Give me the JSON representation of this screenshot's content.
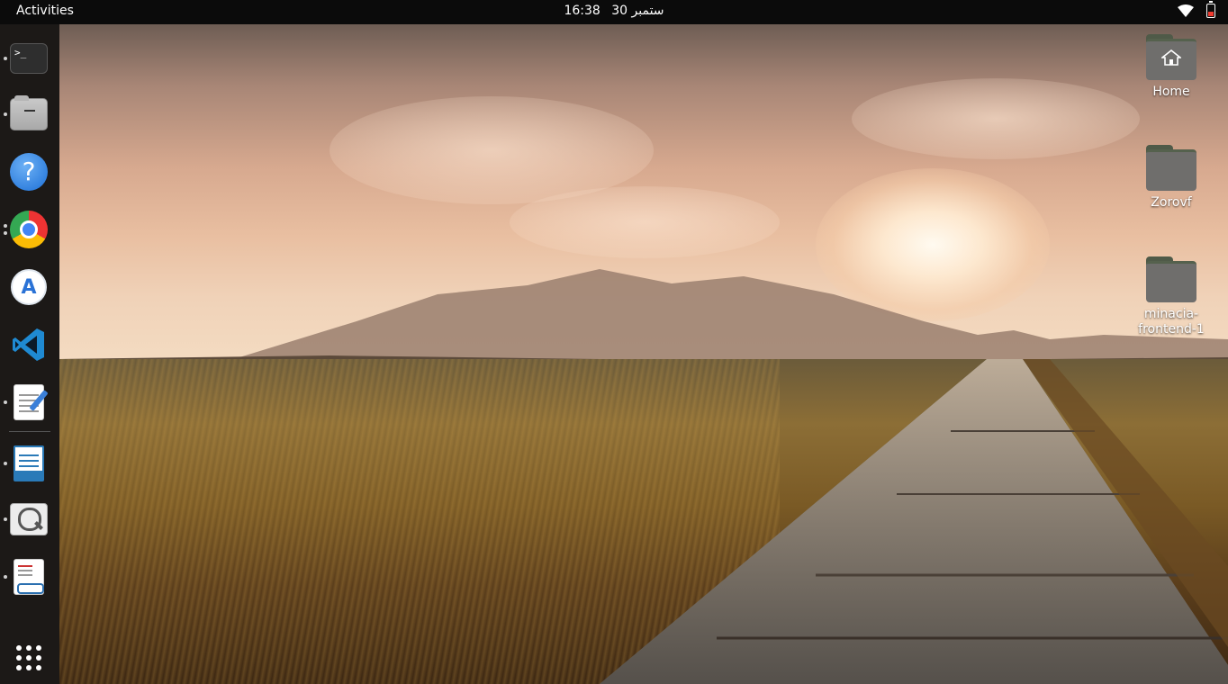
{
  "topbar": {
    "activities_label": "Activities",
    "clock_time": "16:38",
    "clock_date": "30 ستمبر",
    "wifi_icon": "wifi-icon",
    "battery_icon": "battery-icon",
    "battery_color": "#ef3b30"
  },
  "dock": {
    "items": [
      {
        "name": "terminal",
        "icon": "terminal-icon",
        "glyph": ">_",
        "running": true
      },
      {
        "name": "files",
        "icon": "files-icon",
        "running": true
      },
      {
        "name": "help",
        "icon": "help-icon",
        "glyph": "?",
        "running": false
      },
      {
        "name": "chrome",
        "icon": "chrome-icon",
        "running": true
      },
      {
        "name": "android-studio",
        "icon": "android-studio-icon",
        "glyph": "A",
        "running": false
      },
      {
        "name": "vscode",
        "icon": "vscode-icon",
        "running": false
      },
      {
        "name": "text-editor",
        "icon": "text-editor-icon",
        "running": true
      },
      {
        "name": "libreoffice-writer",
        "icon": "writer-icon",
        "running": true
      },
      {
        "name": "image-viewer",
        "icon": "image-viewer-icon",
        "running": true
      },
      {
        "name": "document-viewer",
        "icon": "document-viewer-icon",
        "running": true
      }
    ],
    "show_apps_icon": "app-grid-icon"
  },
  "desktop": {
    "icons": [
      {
        "label": "Home",
        "icon": "home-folder-icon"
      },
      {
        "label": "Zorovf",
        "icon": "folder-icon"
      },
      {
        "label": "minacia-\nfrontend-1",
        "label_line1": "minacia-",
        "label_line2": "frontend-1",
        "icon": "folder-icon"
      }
    ]
  },
  "wallpaper": {
    "description_icon": "wallpaper-image"
  }
}
